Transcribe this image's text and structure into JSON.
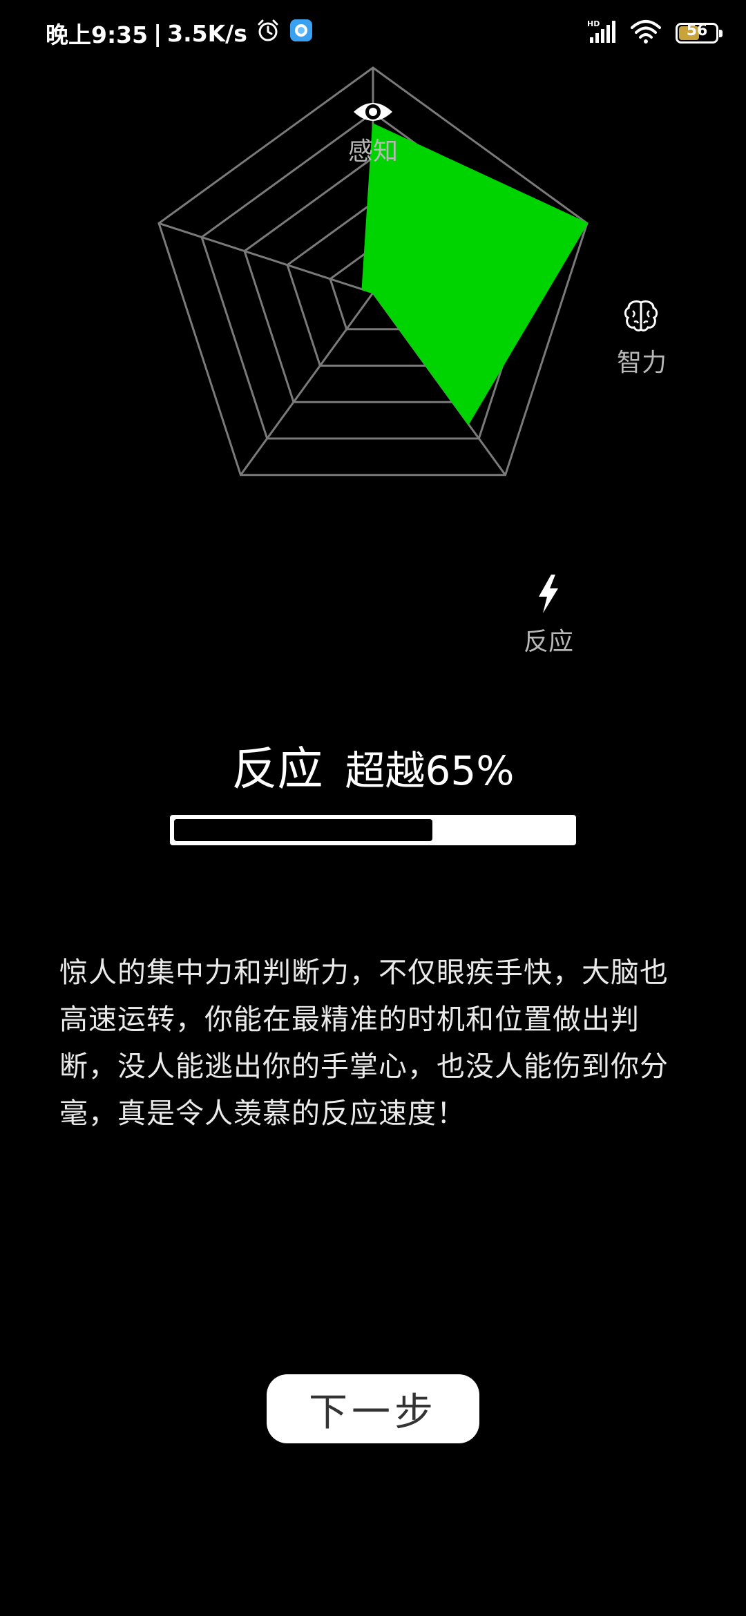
{
  "status_bar": {
    "time": "晚上9:35",
    "separator": "|",
    "network_speed": "3.5K/s",
    "battery_level": "56",
    "battery_fraction": 0.56,
    "icons": [
      "alarm-icon",
      "app-notification-icon",
      "hd-signal-icon",
      "wifi-icon",
      "battery-icon"
    ]
  },
  "radar": {
    "axes": [
      {
        "key": "perception",
        "label": "感知",
        "icon": "eye-icon"
      },
      {
        "key": "intelligence",
        "label": "智力",
        "icon": "brain-icon"
      },
      {
        "key": "reaction",
        "label": "反应",
        "icon": "lightning-icon"
      },
      {
        "key": "axis4",
        "label": "",
        "icon": ""
      },
      {
        "key": "axis5",
        "label": "",
        "icon": ""
      }
    ],
    "values": [
      0.75,
      1.0,
      0.72,
      0.0,
      0.05
    ],
    "rings": 5,
    "fill_color": "#00d400",
    "grid_color": "#7a7a7a"
  },
  "result": {
    "stat_name": "反应",
    "stat_value": "超越65%",
    "percent": 0.65
  },
  "description": "惊人的集中力和判断力，不仅眼疾手快，大脑也高速运转，你能在最精准的时机和位置做出判断，没人能逃出你的手掌心，也没人能伤到你分毫，真是令人羡慕的反应速度！",
  "next_button": {
    "label": "下一步"
  }
}
